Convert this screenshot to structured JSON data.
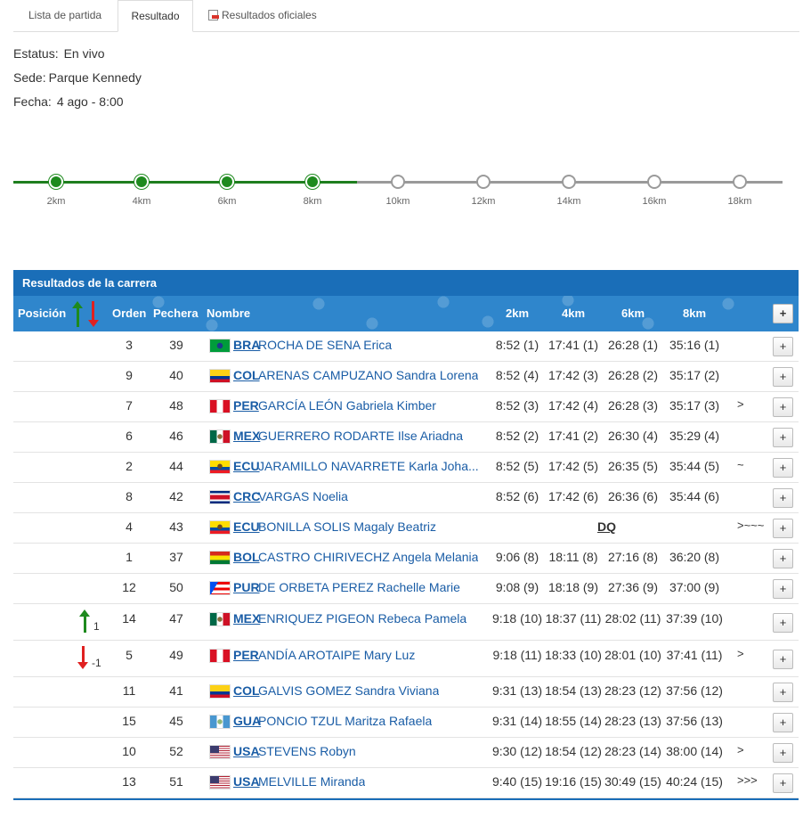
{
  "tabs": [
    {
      "label": "Lista de partida"
    },
    {
      "label": "Resultado"
    },
    {
      "label": "Resultados oficiales"
    }
  ],
  "info": {
    "status_label": "Estatus:",
    "status_value": "En vivo",
    "venue_label": "Sede:",
    "venue_value": "Parque Kennedy",
    "date_label": "Fecha:",
    "date_value": "4 ago - 8:00"
  },
  "progress": {
    "checkpoints": [
      "2km",
      "4km",
      "6km",
      "8km",
      "10km",
      "12km",
      "14km",
      "16km",
      "18km"
    ],
    "completed_count": 4,
    "colors": {
      "done": "#1e8a1e",
      "pending": "#9a9a9a"
    }
  },
  "table": {
    "title": "Resultados de la carrera",
    "headers": {
      "position": "Posición",
      "order": "Orden",
      "bib": "Pechera",
      "name": "Nombre",
      "splits": [
        "2km",
        "4km",
        "6km",
        "8km"
      ],
      "expand": "+"
    },
    "header_icon": "position-change-arrows-icon",
    "rows": [
      {
        "change": "",
        "change_val": "",
        "order": "3",
        "bib": "39",
        "flag": "BRA",
        "country": "BRA",
        "name": "ROCHA DE SENA Erica",
        "s1": "8:52 (1)",
        "s2": "17:41 (1)",
        "s3": "26:28 (1)",
        "s4": "35:16 (1)",
        "note": "",
        "dq": ""
      },
      {
        "change": "",
        "change_val": "",
        "order": "9",
        "bib": "40",
        "flag": "COL",
        "country": "COL",
        "name": "ARENAS CAMPUZANO Sandra Lorena",
        "s1": "8:52 (4)",
        "s2": "17:42 (3)",
        "s3": "26:28 (2)",
        "s4": "35:17 (2)",
        "note": "",
        "dq": ""
      },
      {
        "change": "",
        "change_val": "",
        "order": "7",
        "bib": "48",
        "flag": "PER",
        "country": "PER",
        "name": "GARCÍA LEÓN Gabriela Kimber",
        "s1": "8:52 (3)",
        "s2": "17:42 (4)",
        "s3": "26:28 (3)",
        "s4": "35:17 (3)",
        "note": ">",
        "dq": ""
      },
      {
        "change": "",
        "change_val": "",
        "order": "6",
        "bib": "46",
        "flag": "MEX",
        "country": "MEX",
        "name": "GUERRERO RODARTE Ilse Ariadna",
        "s1": "8:52 (2)",
        "s2": "17:41 (2)",
        "s3": "26:30 (4)",
        "s4": "35:29 (4)",
        "note": "",
        "dq": ""
      },
      {
        "change": "",
        "change_val": "",
        "order": "2",
        "bib": "44",
        "flag": "ECU",
        "country": "ECU",
        "name": "JARAMILLO NAVARRETE Karla Joha...",
        "s1": "8:52 (5)",
        "s2": "17:42 (5)",
        "s3": "26:35 (5)",
        "s4": "35:44 (5)",
        "note": "~",
        "dq": ""
      },
      {
        "change": "",
        "change_val": "",
        "order": "8",
        "bib": "42",
        "flag": "CRC",
        "country": "CRC",
        "name": "VARGAS Noelia",
        "s1": "8:52 (6)",
        "s2": "17:42 (6)",
        "s3": "26:36 (6)",
        "s4": "35:44 (6)",
        "note": "",
        "dq": ""
      },
      {
        "change": "",
        "change_val": "",
        "order": "4",
        "bib": "43",
        "flag": "ECU",
        "country": "ECU",
        "name": "BONILLA SOLIS Magaly Beatriz",
        "s1": "",
        "s2": "",
        "s3": "",
        "s4": "",
        "note": ">~~~",
        "dq": "DQ"
      },
      {
        "change": "",
        "change_val": "",
        "order": "1",
        "bib": "37",
        "flag": "BOL",
        "country": "BOL",
        "name": "CASTRO CHIRIVECHZ Angela Melania",
        "s1": "9:06 (8)",
        "s2": "18:11 (8)",
        "s3": "27:16 (8)",
        "s4": "36:20 (8)",
        "note": "",
        "dq": ""
      },
      {
        "change": "",
        "change_val": "",
        "order": "12",
        "bib": "50",
        "flag": "PUR",
        "country": "PUR",
        "name": "DE ORBETA PEREZ Rachelle Marie",
        "s1": "9:08 (9)",
        "s2": "18:18 (9)",
        "s3": "27:36 (9)",
        "s4": "37:00 (9)",
        "note": "",
        "dq": ""
      },
      {
        "change": "up",
        "change_val": "1",
        "order": "14",
        "bib": "47",
        "flag": "MEX",
        "country": "MEX",
        "name": "ENRIQUEZ PIGEON Rebeca Pamela",
        "s1": "9:18 (10)",
        "s2": "18:37 (11)",
        "s3": "28:02 (11)",
        "s4": "37:39 (10)",
        "note": "",
        "dq": ""
      },
      {
        "change": "down",
        "change_val": "-1",
        "order": "5",
        "bib": "49",
        "flag": "PER",
        "country": "PER",
        "name": "ANDÍA AROTAIPE Mary Luz",
        "s1": "9:18 (11)",
        "s2": "18:33 (10)",
        "s3": "28:01 (10)",
        "s4": "37:41 (11)",
        "note": ">",
        "dq": ""
      },
      {
        "change": "",
        "change_val": "",
        "order": "11",
        "bib": "41",
        "flag": "COL",
        "country": "COL",
        "name": "GALVIS GOMEZ Sandra Viviana",
        "s1": "9:31 (13)",
        "s2": "18:54 (13)",
        "s3": "28:23 (12)",
        "s4": "37:56 (12)",
        "note": "",
        "dq": ""
      },
      {
        "change": "",
        "change_val": "",
        "order": "15",
        "bib": "45",
        "flag": "GUA",
        "country": "GUA",
        "name": "PONCIO TZUL Maritza Rafaela",
        "s1": "9:31 (14)",
        "s2": "18:55 (14)",
        "s3": "28:23 (13)",
        "s4": "37:56 (13)",
        "note": "",
        "dq": ""
      },
      {
        "change": "",
        "change_val": "",
        "order": "10",
        "bib": "52",
        "flag": "USA",
        "country": "USA",
        "name": "STEVENS Robyn",
        "s1": "9:30 (12)",
        "s2": "18:54 (12)",
        "s3": "28:23 (14)",
        "s4": "38:00 (14)",
        "note": ">",
        "dq": ""
      },
      {
        "change": "",
        "change_val": "",
        "order": "13",
        "bib": "51",
        "flag": "USA",
        "country": "USA",
        "name": "MELVILLE Miranda",
        "s1": "9:40 (15)",
        "s2": "19:16 (15)",
        "s3": "30:49 (15)",
        "s4": "40:24 (15)",
        "note": ">>>",
        "dq": ""
      }
    ],
    "expand_label": "+"
  },
  "colors": {
    "header_dark": "#1a6eb8",
    "header_light": "#2f86cc",
    "link": "#1a5da6",
    "up": "#1e8a1e",
    "down": "#e02020"
  }
}
